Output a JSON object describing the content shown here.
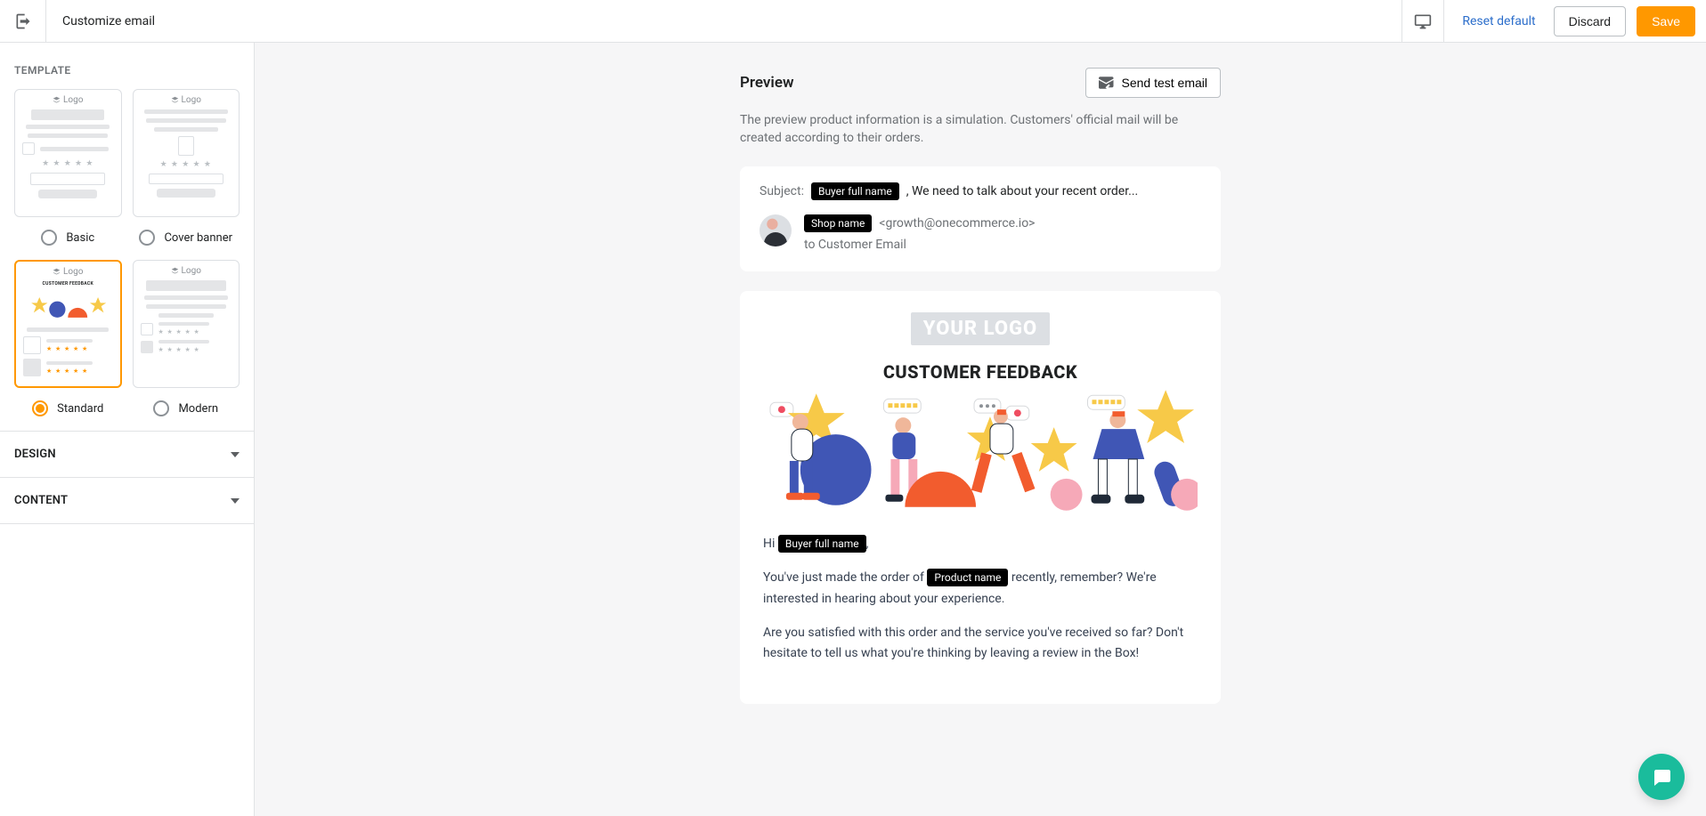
{
  "topbar": {
    "title": "Customize email",
    "reset_label": "Reset default",
    "discard_label": "Discard",
    "save_label": "Save"
  },
  "sidebar": {
    "template_section_label": "TEMPLATE",
    "logo_placeholder": "Logo",
    "templates": [
      {
        "name": "Basic",
        "selected": false
      },
      {
        "name": "Cover banner",
        "selected": false
      },
      {
        "name": "Standard",
        "selected": true
      },
      {
        "name": "Modern",
        "selected": false
      }
    ],
    "design_section_label": "DESIGN",
    "content_section_label": "CONTENT"
  },
  "preview": {
    "title": "Preview",
    "send_test_label": "Send test email",
    "note": "The preview product information is a simulation. Customers' official mail will be created according to their orders.",
    "subject_label": "Subject:",
    "subject_rest": ", We need to talk about your recent order...",
    "buyer_name_pill": "Buyer full name",
    "shop_name_pill": "Shop name",
    "product_name_pill": "Product name",
    "from_email_display": "<growth@onecommerce.io>",
    "to_line": "to Customer Email",
    "logo_placeholder": "YOUR LOGO",
    "feedback_heading": "CUSTOMER FEEDBACK",
    "body_hi": "Hi ",
    "body_p1_before": "You've just made the order of ",
    "body_p1_after": " recently, remember? We're interested in hearing about your experience.",
    "body_p2": "Are you satisfied with this order and the service you've received so far? Don't hesitate to tell us what you're thinking by leaving a review in the Box!"
  }
}
